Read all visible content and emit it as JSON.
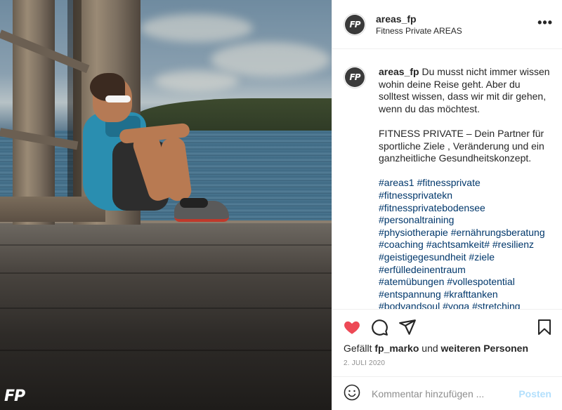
{
  "post": {
    "username": "areas_fp",
    "location": "Fitness Private AREAS",
    "avatar_text": "FP",
    "watermark": "FP"
  },
  "caption": {
    "username": "areas_fp",
    "text1": "Du musst nicht immer wissen wohin deine Reise geht. Aber du solltest wissen, dass wir mit dir gehen, wenn du das möchtest.",
    "text2": "FITNESS PRIVATE – Dein Partner für sportliche Ziele , Veränderung und ein ganzheitliche Gesundheitskonzept.",
    "hashtag_lines": [
      "#areas1 #fitnessprivate",
      "#fitnessprivatekn",
      "#fitnessprivatebodensee",
      "#personaltraining",
      "#physiotherapie #ernährungsberatung",
      "#coaching #achtsamkeit# #resilienz",
      "#geistigegesundheit #ziele",
      "#erfülledeinentraum",
      "#atemübungen #vollespotential",
      "#entspannung #krafttanken",
      "#bodyandsoul #yoga #stretching"
    ]
  },
  "actions": {
    "like_icon": "heart-icon",
    "comment_icon": "comment-icon",
    "share_icon": "share-icon",
    "save_icon": "bookmark-icon",
    "liked_color": "#ed4956"
  },
  "likes": {
    "prefix": "Gefällt",
    "user": "fp_marko",
    "middle": "und",
    "others": "weiteren Personen"
  },
  "date": "2. JULI 2020",
  "comment": {
    "placeholder": "Kommentar hinzufügen ...",
    "post_label": "Posten",
    "emoji_icon": "emoji-icon"
  },
  "more_label": "•••"
}
